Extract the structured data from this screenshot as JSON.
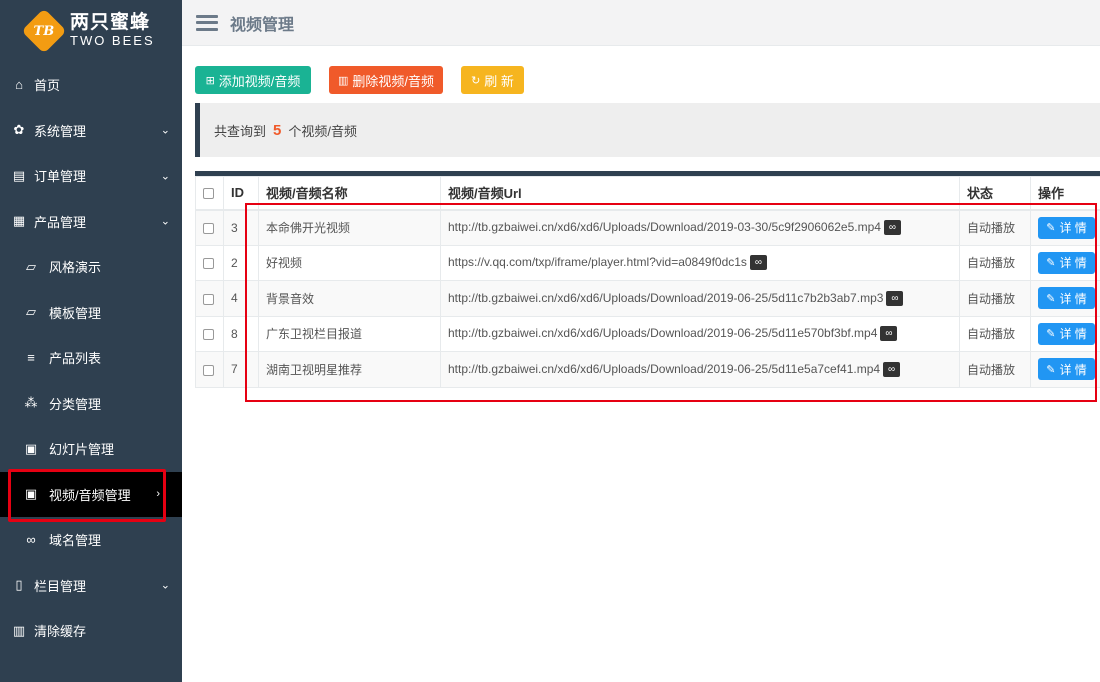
{
  "logo": {
    "mark": "TB",
    "name_cn": "两只蜜蜂",
    "name_en": "TWO BEES"
  },
  "sidebar": {
    "items": [
      {
        "label": "首页",
        "icon": "home-icon",
        "glyph": "⌂",
        "chev": ""
      },
      {
        "label": "系统管理",
        "icon": "gear-icon",
        "glyph": "✿",
        "chev": "⌄"
      },
      {
        "label": "订单管理",
        "icon": "list-icon",
        "glyph": "▤",
        "chev": "⌄"
      },
      {
        "label": "产品管理",
        "icon": "grid-icon",
        "glyph": "▦",
        "chev": "⌄"
      },
      {
        "label": "风格演示",
        "icon": "folder-open-icon",
        "glyph": "▱",
        "chev": "",
        "sub": true
      },
      {
        "label": "模板管理",
        "icon": "folder-open-icon",
        "glyph": "▱",
        "chev": "",
        "sub": true
      },
      {
        "label": "产品列表",
        "icon": "bars-icon",
        "glyph": "≡",
        "chev": "",
        "sub": true
      },
      {
        "label": "分类管理",
        "icon": "sitemap-icon",
        "glyph": "⁂",
        "chev": "",
        "sub": true
      },
      {
        "label": "幻灯片管理",
        "icon": "image-icon",
        "glyph": "▣",
        "chev": "",
        "sub": true
      },
      {
        "label": "视频/音频管理",
        "icon": "video-file-icon",
        "glyph": "▣",
        "chev": "›",
        "sub": true,
        "active": true
      },
      {
        "label": "域名管理",
        "icon": "link-icon",
        "glyph": "∞",
        "chev": "",
        "sub": true
      },
      {
        "label": "栏目管理",
        "icon": "file-text-icon",
        "glyph": "▯",
        "chev": "⌄"
      },
      {
        "label": "清除缓存",
        "icon": "trash-icon",
        "glyph": "▥",
        "chev": ""
      }
    ]
  },
  "header": {
    "title": "视频管理"
  },
  "toolbar": {
    "add_label": "添加视频/音频",
    "delete_label": "删除视频/音频",
    "refresh_label": "刷 新"
  },
  "info": {
    "prefix": "共查询到",
    "count": "5",
    "suffix": "个视频/音频"
  },
  "table": {
    "headers": [
      "ID",
      "视频/音频名称",
      "视频/音频Url",
      "状态",
      "操作"
    ],
    "detail_label": "详 情",
    "rows": [
      {
        "id": "3",
        "name": "本命佛开光视频",
        "url": "http://tb.gzbaiwei.cn/xd6/xd6/Uploads/Download/2019-03-30/5c9f2906062e5.mp4",
        "status": "自动播放"
      },
      {
        "id": "2",
        "name": "好视频",
        "url": "https://v.qq.com/txp/iframe/player.html?vid=a0849f0dc1s",
        "status": "自动播放"
      },
      {
        "id": "4",
        "name": "背景音效",
        "url": "http://tb.gzbaiwei.cn/xd6/xd6/Uploads/Download/2019-06-25/5d11c7b2b3ab7.mp3",
        "status": "自动播放"
      },
      {
        "id": "8",
        "name": "广东卫视栏目报道",
        "url": "http://tb.gzbaiwei.cn/xd6/xd6/Uploads/Download/2019-06-25/5d11e570bf3bf.mp4",
        "status": "自动播放"
      },
      {
        "id": "7",
        "name": "湖南卫视明星推荐",
        "url": "http://tb.gzbaiwei.cn/xd6/xd6/Uploads/Download/2019-06-25/5d11e5a7cef41.mp4",
        "status": "自动播放"
      }
    ]
  },
  "colors": {
    "sidebar_bg": "#2f4050",
    "add": "#1ab394",
    "delete": "#f05a2a",
    "refresh": "#f6b51f",
    "detail": "#2196f3",
    "highlight": "#e60012"
  }
}
